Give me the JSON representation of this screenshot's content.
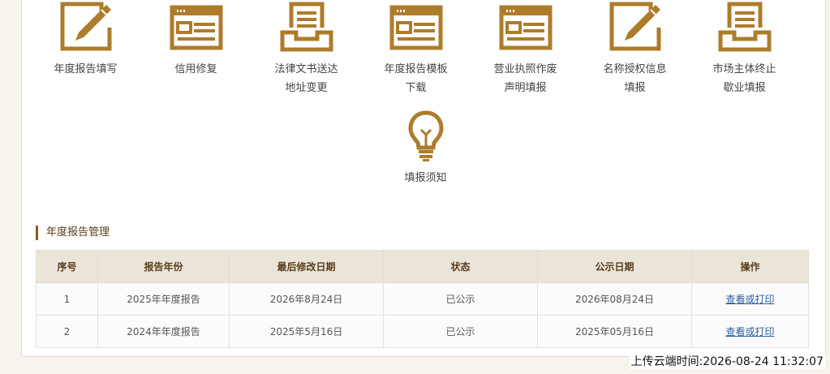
{
  "accent_color": "#ad7c2b",
  "tiles": [
    {
      "label": "年度报告填写",
      "icon": "edit-form-icon"
    },
    {
      "label": "信用修复",
      "icon": "document-card-icon"
    },
    {
      "label": "法律文书送达\n地址变更",
      "icon": "inbox-tray-icon"
    },
    {
      "label": "年度报告模板\n下载",
      "icon": "document-card-icon"
    },
    {
      "label": "营业执照作废\n声明填报",
      "icon": "document-card-icon"
    },
    {
      "label": "名称授权信息\n填报",
      "icon": "edit-form-icon"
    },
    {
      "label": "市场主体终止\n歇业填报",
      "icon": "inbox-tray-icon"
    },
    {
      "label": "填报须知",
      "icon": "lightbulb-icon"
    }
  ],
  "section": {
    "title": "年度报告管理"
  },
  "table": {
    "headers": [
      "序号",
      "报告年份",
      "最后修改日期",
      "状态",
      "公示日期",
      "操作"
    ],
    "rows": [
      [
        "1",
        "2025年年度报告",
        "2026年8月24日",
        "已公示",
        "2026年08月24日",
        "查看或打印"
      ],
      [
        "2",
        "2024年年度报告",
        "2025年5月16日",
        "已公示",
        "2025年05月16日",
        "查看或打印"
      ]
    ]
  },
  "upload_time": "上传云端时间:2026-08-24 11:32:07"
}
